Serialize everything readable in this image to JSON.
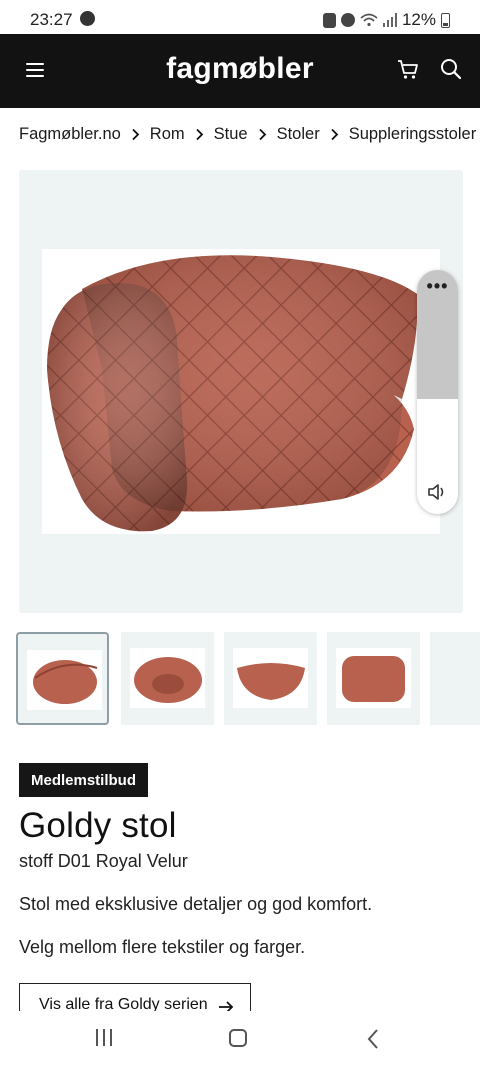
{
  "status_bar": {
    "time": "23:27",
    "battery": "12%"
  },
  "header": {
    "logo": "fagmøbler"
  },
  "breadcrumb": [
    "Fagmøbler.no",
    "Rom",
    "Stue",
    "Stoler",
    "Suppleringsstoler"
  ],
  "gallery": {
    "thumbnail_count": 5,
    "active_index": 0
  },
  "media_control": {
    "more_label": "•••",
    "volume_level": 0.53
  },
  "product": {
    "badge": "Medlemstilbud",
    "name": "Goldy stol",
    "variant": "stoff D01 Royal Velur",
    "description_1": "Stol med eksklusive detaljer og god komfort.",
    "description_2": "Velg mellom flere tekstiler og farger.",
    "series_button": "Vis alle fra Goldy serien"
  },
  "colors": {
    "header_bg": "#121212",
    "image_bg": "#eef3f3",
    "chair": "#b8614f",
    "badge_bg": "#161616"
  }
}
